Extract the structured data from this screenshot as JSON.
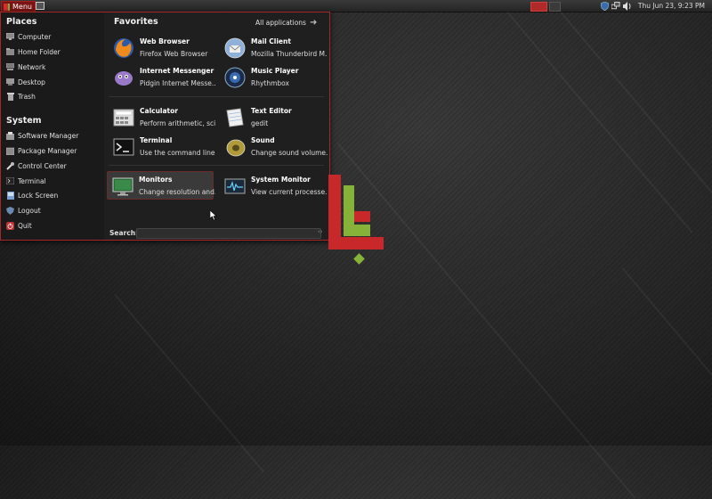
{
  "top_panel": {
    "menu_label": "Menu",
    "clock": "Thu Jun 23, 9:23 PM",
    "tray_icons": [
      "shield-icon",
      "network-icon",
      "volume-icon"
    ]
  },
  "sidebar": {
    "places_title": "Places",
    "places": [
      {
        "label": "Computer",
        "icon": "computer-icon"
      },
      {
        "label": "Home Folder",
        "icon": "home-folder-icon"
      },
      {
        "label": "Network",
        "icon": "network-icon"
      },
      {
        "label": "Desktop",
        "icon": "desktop-icon"
      },
      {
        "label": "Trash",
        "icon": "trash-icon"
      }
    ],
    "system_title": "System",
    "system": [
      {
        "label": "Software Manager",
        "icon": "software-manager-icon"
      },
      {
        "label": "Package Manager",
        "icon": "package-manager-icon"
      },
      {
        "label": "Control Center",
        "icon": "control-center-icon"
      },
      {
        "label": "Terminal",
        "icon": "terminal-icon"
      },
      {
        "label": "Lock Screen",
        "icon": "lock-icon"
      },
      {
        "label": "Logout",
        "icon": "logout-icon"
      },
      {
        "label": "Quit",
        "icon": "quit-icon"
      }
    ]
  },
  "favorites": {
    "title": "Favorites",
    "all_apps_label": "All applications",
    "apps": [
      {
        "name": "Web Browser",
        "desc": "Firefox Web Browser"
      },
      {
        "name": "Mail Client",
        "desc": "Mozilla Thunderbird M..."
      },
      {
        "name": "Internet Messenger",
        "desc": "Pidgin Internet Messe..."
      },
      {
        "name": "Music Player",
        "desc": "Rhythmbox"
      },
      {
        "name": "Calculator",
        "desc": "Perform arithmetic, sci..."
      },
      {
        "name": "Text Editor",
        "desc": "gedit"
      },
      {
        "name": "Terminal",
        "desc": "Use the command line"
      },
      {
        "name": "Sound",
        "desc": "Change sound volume..."
      },
      {
        "name": "Monitors",
        "desc": "Change resolution and..."
      },
      {
        "name": "System Monitor",
        "desc": "View current processe..."
      }
    ]
  },
  "search": {
    "label": "Search:",
    "value": ""
  },
  "colors": {
    "accent": "#a02a2a",
    "logo_red": "#c8282a",
    "logo_green": "#86b23a"
  }
}
